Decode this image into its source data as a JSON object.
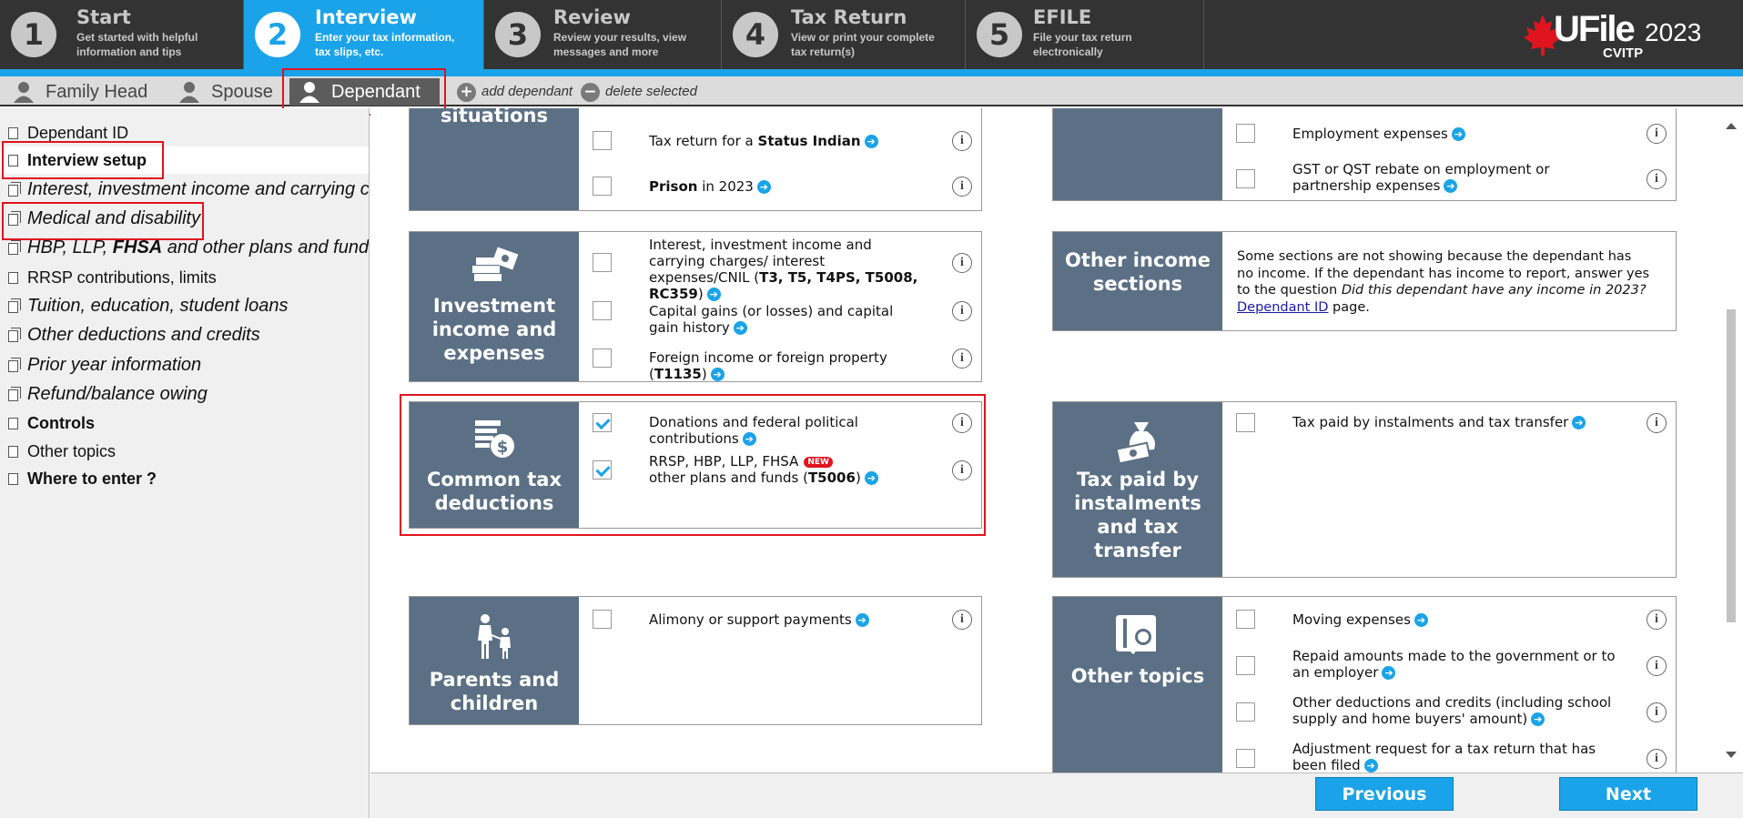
{
  "topnav": {
    "steps": [
      {
        "num": "1",
        "title": "Start",
        "sub": "Get started with helpful\ninformation and tips"
      },
      {
        "num": "2",
        "title": "Interview",
        "sub": "Enter your tax information,\ntax slips, etc."
      },
      {
        "num": "3",
        "title": "Review",
        "sub": "Review your results, view\nmessages and more"
      },
      {
        "num": "4",
        "title": "Tax Return",
        "sub": "View or print your complete\ntax return(s)"
      },
      {
        "num": "5",
        "title": "EFILE",
        "sub": "File your tax return\nelectronically"
      }
    ],
    "active_step": "2",
    "brand": {
      "name": "UFile",
      "year": "2023",
      "sub": "CVITP"
    }
  },
  "person_tabs": {
    "tabs": [
      {
        "label": "Family Head",
        "icon": "person-icon"
      },
      {
        "label": "Spouse",
        "icon": "person-icon"
      },
      {
        "label": "Dependant",
        "icon": "person-icon",
        "active": true
      }
    ],
    "add_label": "add dependant",
    "delete_label": "delete selected"
  },
  "sidebar": {
    "items": [
      {
        "label": "Dependant ID",
        "style": "normal",
        "multi": false
      },
      {
        "label": "Interview setup",
        "style": "bold",
        "multi": false,
        "selected": true
      },
      {
        "label": "Interest, investment income and carrying charges",
        "style": "italic",
        "multi": true
      },
      {
        "label": "Medical and disability",
        "style": "italic",
        "multi": true
      },
      {
        "label": "HBP, LLP, FHSA and other plans and funds",
        "style": "italic",
        "multi": true
      },
      {
        "label": "RRSP contributions, limits",
        "style": "normal",
        "multi": false
      },
      {
        "label": "Tuition, education, student loans",
        "style": "italic",
        "multi": true
      },
      {
        "label": "Other deductions and credits",
        "style": "italic",
        "multi": true
      },
      {
        "label": "Prior year information",
        "style": "italic",
        "multi": true
      },
      {
        "label": "Refund/balance owing",
        "style": "italic",
        "multi": true
      },
      {
        "label": "Controls",
        "style": "bold",
        "multi": false
      },
      {
        "label": "Other topics",
        "style": "normal",
        "multi": false
      },
      {
        "label": "Where to enter ?",
        "style": "bold",
        "multi": false
      }
    ],
    "hbp_parts": [
      "HBP, LLP, ",
      "FHSA",
      " and other plans and funds"
    ]
  },
  "cards": {
    "situations": {
      "title": "situations",
      "rows": [
        {
          "pre": "Tax return for a ",
          "bold": "Status Indian",
          "post": "",
          "checked": false
        },
        {
          "pre": "",
          "bold": "Prison",
          "post": " in 2023",
          "checked": false
        }
      ]
    },
    "employment": {
      "rows": [
        {
          "text": "Employment expenses",
          "checked": false
        },
        {
          "text": "GST or QST rebate on employment or partnership expenses",
          "checked": false
        }
      ]
    },
    "investment": {
      "title": "Investment income and expenses",
      "rows": [
        {
          "pre": "Interest, investment income and carrying charges/ interest expenses/CNIL (",
          "bold": "T3, T5, T4PS, T5008, RC359",
          "post": ")",
          "checked": false
        },
        {
          "pre": "Capital gains (or losses) and capital gain history",
          "bold": "",
          "post": "",
          "checked": false
        },
        {
          "pre": "Foreign income or foreign property (",
          "bold": "T1135",
          "post": ")",
          "checked": false
        }
      ]
    },
    "other_income": {
      "title": "Other income sections",
      "message_pre": "Some sections are not showing because the dependant has no income. If the dependant has income to report, answer yes to the question ",
      "message_italic": "Did this dependant have any income in 2023?",
      "link": "Dependant ID",
      "message_post": " page."
    },
    "common": {
      "title": "Common tax deductions",
      "rows": [
        {
          "text": "Donations and federal political contributions",
          "checked": true
        },
        {
          "line1": "RRSP, HBP, LLP, FHSA",
          "badge": "NEW",
          "pre2": "other plans and funds (",
          "bold2": "T5006",
          "post2": ")",
          "checked": true
        }
      ]
    },
    "instalments": {
      "title": "Tax paid by instalments and tax transfer",
      "rows": [
        {
          "text": "Tax paid by instalments and tax transfer",
          "checked": false
        }
      ]
    },
    "parents": {
      "title": "Parents and children",
      "rows": [
        {
          "text": "Alimony or support payments",
          "checked": false
        }
      ]
    },
    "other_topics": {
      "title": "Other topics",
      "rows": [
        {
          "text": "Moving expenses",
          "checked": false
        },
        {
          "text": "Repaid amounts made to the government or to an employer",
          "checked": false
        },
        {
          "text": "Other deductions and credits (including school supply and home buyers' amount)",
          "checked": false
        },
        {
          "text": "Adjustment request for a tax return that has been filed",
          "checked": false
        }
      ]
    }
  },
  "footer": {
    "previous": "Previous",
    "next": "Next"
  },
  "colors": {
    "accent": "#1aa3e8",
    "card_side": "#5c7085",
    "highlight": "#e0141e",
    "topbar": "#333333"
  }
}
